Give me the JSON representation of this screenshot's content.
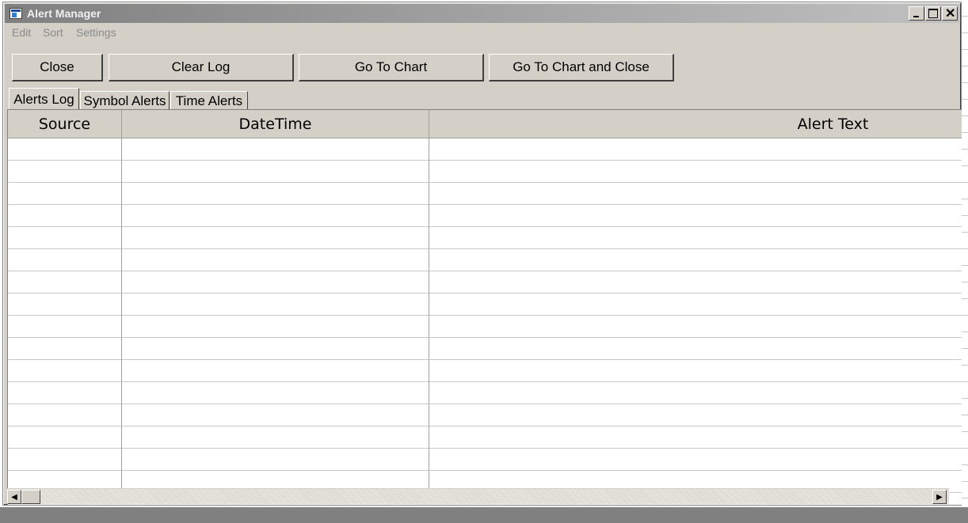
{
  "window": {
    "title": "Alert Manager"
  },
  "menu": [
    "Edit",
    "Sort",
    "Settings"
  ],
  "buttons": {
    "close": "Close",
    "clear_log": "Clear Log",
    "go_to_chart": "Go To Chart",
    "go_to_chart_close": "Go To Chart and Close"
  },
  "tabs": [
    {
      "label": "Alerts Log",
      "active": true
    },
    {
      "label": "Symbol Alerts",
      "active": false
    },
    {
      "label": "Time Alerts",
      "active": false
    }
  ],
  "table": {
    "columns": [
      "Source",
      "DateTime",
      "Alert Text"
    ],
    "rows": []
  },
  "icons": {
    "app": "alert-manager-app-icon",
    "minimize": "minimize-icon",
    "maximize": "maximize-icon",
    "close": "close-icon",
    "scroll_left": "arrow-left-icon",
    "scroll_right": "arrow-right-icon"
  }
}
